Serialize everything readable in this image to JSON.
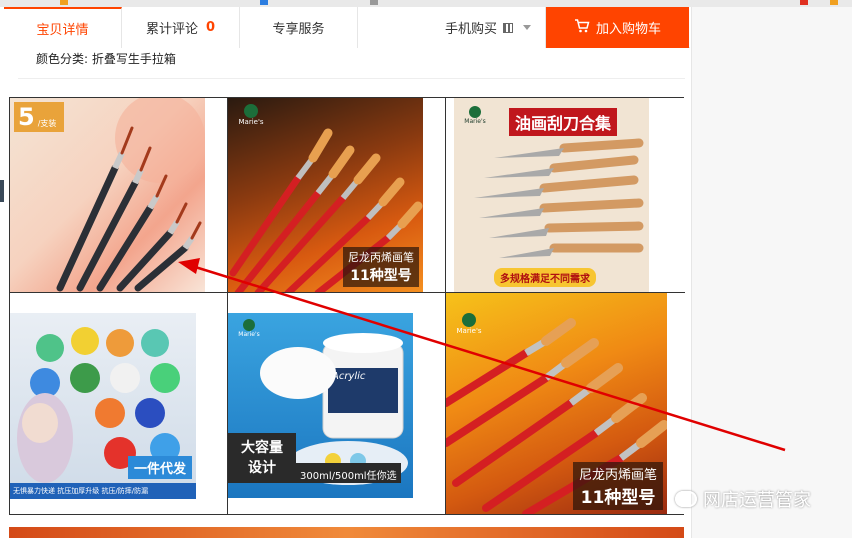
{
  "tabs": {
    "details_label": "宝贝详情",
    "reviews_label": "累计评论",
    "reviews_count": "0",
    "service_label": "专享服务",
    "mobile_label": "手机购买",
    "cart_label": "加入购物车"
  },
  "product": {
    "color_category": "颜色分类: 折叠写生手拉箱"
  },
  "images": {
    "img1_badge": "5",
    "img1_badge_sub": "/支装",
    "img2_caption_1": "尼龙丙烯画笔",
    "img2_caption_2": "11种型号",
    "img3_title": "油画刮刀合集",
    "img3_footer": "多规格满足不同需求",
    "img4_banner": "一件代发",
    "img4_footer": "无惧暴力快递 抗压加厚升级 抗压/防摔/防漏",
    "img5_title_1": "大容量",
    "img5_title_2": "设计",
    "img5_volume": "300ml/500ml任你选",
    "img5_jar_label": "Acrylic",
    "img6_caption_1": "尼龙丙烯画笔",
    "img6_caption_2": "11种型号",
    "brand": "Marie's"
  },
  "watermark": {
    "text": "网店运营管家"
  },
  "colors": {
    "accent": "#ff4400",
    "arrow": "#e00000"
  }
}
